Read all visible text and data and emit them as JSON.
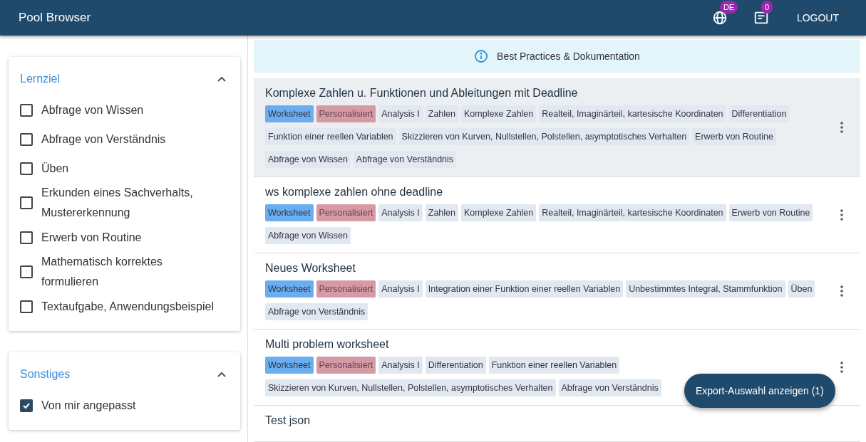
{
  "app_bar": {
    "title": "Pool Browser",
    "language_badge": "DE",
    "notifications_badge": "0",
    "logout": "LOGOUT"
  },
  "filters": [
    {
      "title": "Lernziel",
      "expanded": true,
      "options": [
        {
          "label": "Abfrage von Wissen",
          "checked": false
        },
        {
          "label": "Abfrage von Verständnis",
          "checked": false
        },
        {
          "label": "Üben",
          "checked": false
        },
        {
          "label": "Erkunden eines Sachverhalts, Mustererkennung",
          "checked": false
        },
        {
          "label": "Erwerb von Routine",
          "checked": false
        },
        {
          "label": "Mathematisch korrektes formulieren",
          "checked": false
        },
        {
          "label": "Textaufgabe, Anwendungsbeispiel",
          "checked": false
        }
      ]
    },
    {
      "title": "Sonstiges",
      "expanded": true,
      "options": [
        {
          "label": "Von mir angepasst",
          "checked": true
        }
      ]
    }
  ],
  "info_banner": "Best Practices & Dokumentation",
  "worksheets": [
    {
      "title": "Komplexe Zahlen u. Funktionen und Ableitungen mit Deadline",
      "selected": true,
      "tags": [
        {
          "label": "Worksheet",
          "kind": "type"
        },
        {
          "label": "Personalisiert",
          "kind": "personal"
        },
        {
          "label": "Analysis I",
          "kind": "topic"
        },
        {
          "label": "Zahlen",
          "kind": "topic"
        },
        {
          "label": "Komplexe Zahlen",
          "kind": "topic"
        },
        {
          "label": "Realteil, Imaginärteil, kartesische Koordinaten",
          "kind": "topic"
        },
        {
          "label": "Differentiation",
          "kind": "topic"
        },
        {
          "label": "Funktion einer reellen Variablen",
          "kind": "topic"
        },
        {
          "label": "Skizzieren von Kurven, Nullstellen, Polstellen, asymptotisches Verhalten",
          "kind": "topic"
        },
        {
          "label": "Erwerb von Routine",
          "kind": "topic"
        },
        {
          "label": "Abfrage von Wissen",
          "kind": "topic"
        },
        {
          "label": "Abfrage von Verständnis",
          "kind": "topic"
        }
      ]
    },
    {
      "title": "ws komplexe zahlen ohne deadline",
      "selected": false,
      "tags": [
        {
          "label": "Worksheet",
          "kind": "type"
        },
        {
          "label": "Personalisiert",
          "kind": "personal"
        },
        {
          "label": "Analysis I",
          "kind": "topic"
        },
        {
          "label": "Zahlen",
          "kind": "topic"
        },
        {
          "label": "Komplexe Zahlen",
          "kind": "topic"
        },
        {
          "label": "Realteil, Imaginärteil, kartesische Koordinaten",
          "kind": "topic"
        },
        {
          "label": "Erwerb von Routine",
          "kind": "topic"
        },
        {
          "label": "Abfrage von Wissen",
          "kind": "topic"
        }
      ]
    },
    {
      "title": "Neues Worksheet",
      "selected": false,
      "tags": [
        {
          "label": "Worksheet",
          "kind": "type"
        },
        {
          "label": "Personalisiert",
          "kind": "personal"
        },
        {
          "label": "Analysis I",
          "kind": "topic"
        },
        {
          "label": "Integration einer Funktion einer reellen Variablen",
          "kind": "topic"
        },
        {
          "label": "Unbestimmtes Integral, Stammfunktion",
          "kind": "topic"
        },
        {
          "label": "Üben",
          "kind": "topic"
        },
        {
          "label": "Abfrage von Verständnis",
          "kind": "topic"
        }
      ]
    },
    {
      "title": "Multi problem worksheet",
      "selected": false,
      "tags": [
        {
          "label": "Worksheet",
          "kind": "type"
        },
        {
          "label": "Personalisiert",
          "kind": "personal"
        },
        {
          "label": "Analysis I",
          "kind": "topic"
        },
        {
          "label": "Differentiation",
          "kind": "topic"
        },
        {
          "label": "Funktion einer reellen Variablen",
          "kind": "topic"
        },
        {
          "label": "Skizzieren von Kurven, Nullstellen, Polstellen, asymptotisches Verhalten",
          "kind": "topic"
        },
        {
          "label": "Abfrage von Verständnis",
          "kind": "topic"
        }
      ]
    },
    {
      "title": "Test json",
      "selected": false
    }
  ],
  "export_button": "Export-Auswahl anzeigen (1)"
}
